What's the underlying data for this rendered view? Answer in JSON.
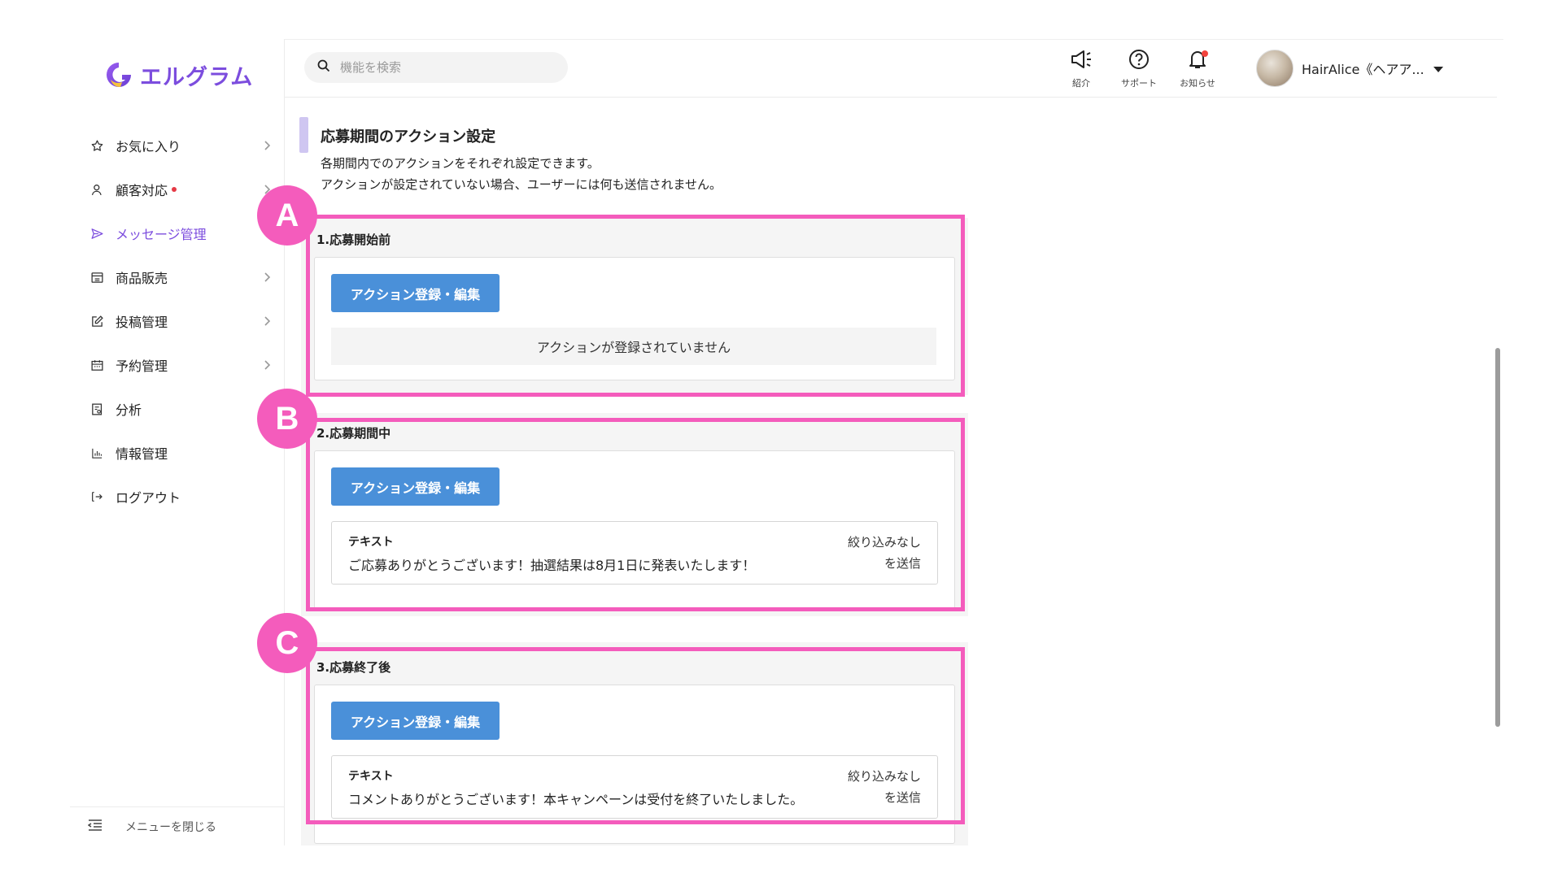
{
  "app": {
    "logo_text": "エルグラム"
  },
  "search": {
    "placeholder": "機能を検索"
  },
  "header": {
    "icons": [
      {
        "name": "megaphone-icon",
        "label": "紹介"
      },
      {
        "name": "help-icon",
        "label": "サポート"
      },
      {
        "name": "bell-icon",
        "label": "お知らせ",
        "has_notification": true
      }
    ],
    "user_name": "HairAlice《ヘアア..."
  },
  "sidebar": {
    "items": [
      {
        "icon": "star-icon",
        "label": "お気に入り",
        "chevron": true
      },
      {
        "icon": "user-icon",
        "label": "顧客対応",
        "chevron": true,
        "dot": true
      },
      {
        "icon": "send-icon",
        "label": "メッセージ管理",
        "active": true
      },
      {
        "icon": "store-icon",
        "label": "商品販売",
        "chevron": true
      },
      {
        "icon": "edit-icon",
        "label": "投稿管理",
        "chevron": true
      },
      {
        "icon": "calendar-icon",
        "label": "予約管理",
        "chevron": true
      },
      {
        "icon": "report-icon",
        "label": "分析",
        "chevron": true
      },
      {
        "icon": "bar-chart-icon",
        "label": "情報管理"
      },
      {
        "icon": "logout-icon",
        "label": "ログアウト"
      }
    ],
    "footer_label": "メニューを閉じる"
  },
  "main": {
    "title": "応募期間のアクション設定",
    "description_lines": [
      "各期間内でのアクションをそれぞれ設定できます。",
      "アクションが設定されていない場合、ユーザーには何も送信されません。"
    ],
    "blocks": [
      {
        "badge": "A",
        "title": "1.応募開始前",
        "button_label": "アクション登録・編集",
        "empty_text": "アクションが登録されていません"
      },
      {
        "badge": "B",
        "title": "2.応募期間中",
        "button_label": "アクション登録・編集",
        "message": {
          "type": "テキスト",
          "text": "ご応募ありがとうございます！抽選結果は8月1日に発表いたします！",
          "filter_line1": "絞り込みなし",
          "filter_line2": "を送信"
        }
      },
      {
        "badge": "C",
        "title": "3.応募終了後",
        "button_label": "アクション登録・編集",
        "message": {
          "type": "テキスト",
          "text": "コメントありがとうございます！本キャンペーンは受付を終了いたしました。",
          "filter_line1": "絞り込みなし",
          "filter_line2": "を送信"
        }
      }
    ]
  },
  "colors": {
    "brand": "#7c4dde",
    "button": "#4a90d9",
    "highlight": "#f45cbc",
    "notification": "#f2433d"
  }
}
